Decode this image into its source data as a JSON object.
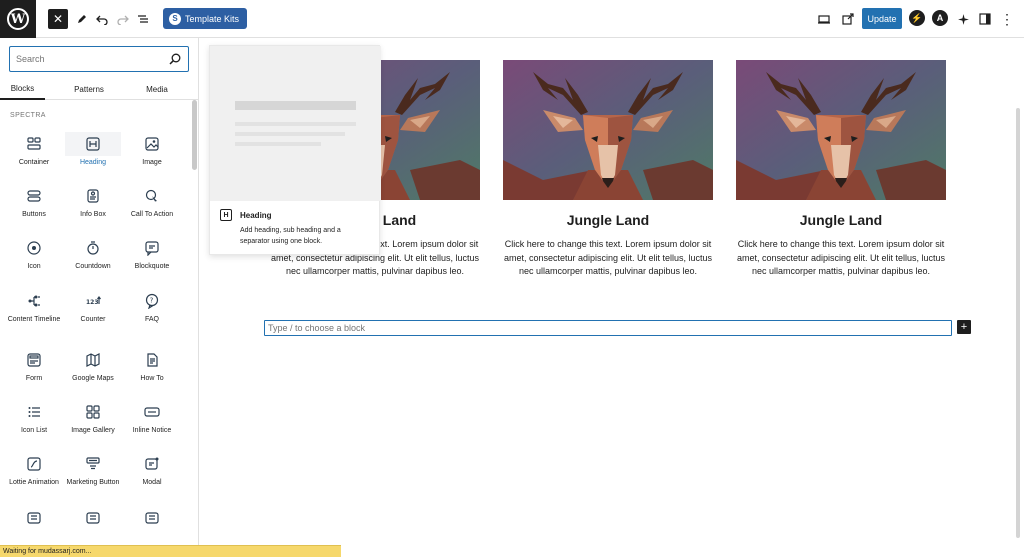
{
  "toolbar": {
    "template_kits_label": "Template Kits",
    "update_label": "Update"
  },
  "inserter": {
    "search_placeholder": "Search",
    "tabs": [
      "Blocks",
      "Patterns",
      "Media"
    ],
    "section_label": "SPECTRA",
    "blocks": [
      {
        "label": "Container",
        "icon": "container-icon"
      },
      {
        "label": "Heading",
        "icon": "heading-icon",
        "selected": true
      },
      {
        "label": "Image",
        "icon": "image-icon"
      },
      {
        "label": "Buttons",
        "icon": "buttons-icon"
      },
      {
        "label": "Info Box",
        "icon": "info-box-icon"
      },
      {
        "label": "Call To Action",
        "icon": "call-to-action-icon"
      },
      {
        "label": "Icon",
        "icon": "icon-icon"
      },
      {
        "label": "Countdown",
        "icon": "countdown-icon"
      },
      {
        "label": "Blockquote",
        "icon": "blockquote-icon"
      },
      {
        "label": "Content Timeline",
        "icon": "content-timeline-icon"
      },
      {
        "label": "Counter",
        "icon": "counter-icon"
      },
      {
        "label": "FAQ",
        "icon": "faq-icon"
      },
      {
        "label": "Form",
        "icon": "form-icon"
      },
      {
        "label": "Google Maps",
        "icon": "google-maps-icon"
      },
      {
        "label": "How To",
        "icon": "how-to-icon"
      },
      {
        "label": "Icon List",
        "icon": "icon-list-icon"
      },
      {
        "label": "Image Gallery",
        "icon": "image-gallery-icon"
      },
      {
        "label": "Inline Notice",
        "icon": "inline-notice-icon"
      },
      {
        "label": "Lottie Animation",
        "icon": "lottie-animation-icon"
      },
      {
        "label": "Marketing Button",
        "icon": "marketing-button-icon"
      },
      {
        "label": "Modal",
        "icon": "modal-icon"
      },
      {
        "label": "",
        "icon": "block-icon"
      },
      {
        "label": "",
        "icon": "block-icon"
      },
      {
        "label": "",
        "icon": "block-icon"
      }
    ]
  },
  "preview": {
    "title": "Heading",
    "description": "Add heading, sub heading and a separator using one block."
  },
  "cards": [
    {
      "title": "Jungle Land",
      "text": "Click here to change this text. Lorem ipsum dolor sit amet, consectetur adipiscing elit. Ut elit tellus, luctus nec ullamcorper mattis, pulvinar dapibus leo."
    },
    {
      "title": "Jungle Land",
      "text": "Click here to change this text. Lorem ipsum dolor sit amet, consectetur adipiscing elit. Ut elit tellus, luctus nec ullamcorper mattis, pulvinar dapibus leo."
    },
    {
      "title": "Jungle Land",
      "text": "Click here to change this text. Lorem ipsum dolor sit amet, consectetur adipiscing elit. Ut elit tellus, luctus nec ullamcorper mattis, pulvinar dapibus leo."
    }
  ],
  "editor": {
    "block_placeholder": "Type / to choose a block"
  },
  "status": {
    "text": "Waiting for mudassarj.com..."
  },
  "colors": {
    "accent": "#2271b1",
    "template_kits": "#2d5fa3",
    "status_bar": "#f6d86c"
  }
}
